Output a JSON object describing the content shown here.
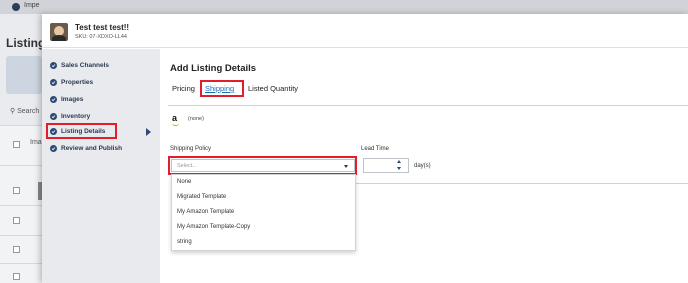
{
  "background": {
    "topbar_text": "Impe",
    "page_title": "Listing",
    "search_text": "Search",
    "column_header": "Ima"
  },
  "item": {
    "title": "Test test test!!",
    "sku": "SKU: 07-XDXO-LL44"
  },
  "sidebar": {
    "items": [
      {
        "label": "Sales Channels"
      },
      {
        "label": "Properties"
      },
      {
        "label": "Images"
      },
      {
        "label": "Inventory"
      },
      {
        "label": "Listing Details"
      },
      {
        "label": "Review and Publish"
      }
    ],
    "active_index": 4
  },
  "main": {
    "section_title": "Add Listing Details",
    "tabs": [
      {
        "label": "Pricing"
      },
      {
        "label": "Shipping"
      },
      {
        "label": "Listed Quantity"
      }
    ],
    "active_tab": "Shipping",
    "channel_icon": "amazon-icon",
    "channel_value": "(none)",
    "shipping_policy_label": "Shipping Policy",
    "shipping_policy_placeholder": "Select...",
    "lead_time_label": "Lead Time",
    "lead_time_unit": "day(s)",
    "dropdown_options": [
      "None",
      "Migrated Template",
      "My Amazon Template",
      "My Amazon Template-Copy",
      "string"
    ]
  },
  "colors": {
    "highlight": "#e01f2b",
    "accent": "#1d6fb8",
    "nav_icon": "#2b4a75"
  }
}
